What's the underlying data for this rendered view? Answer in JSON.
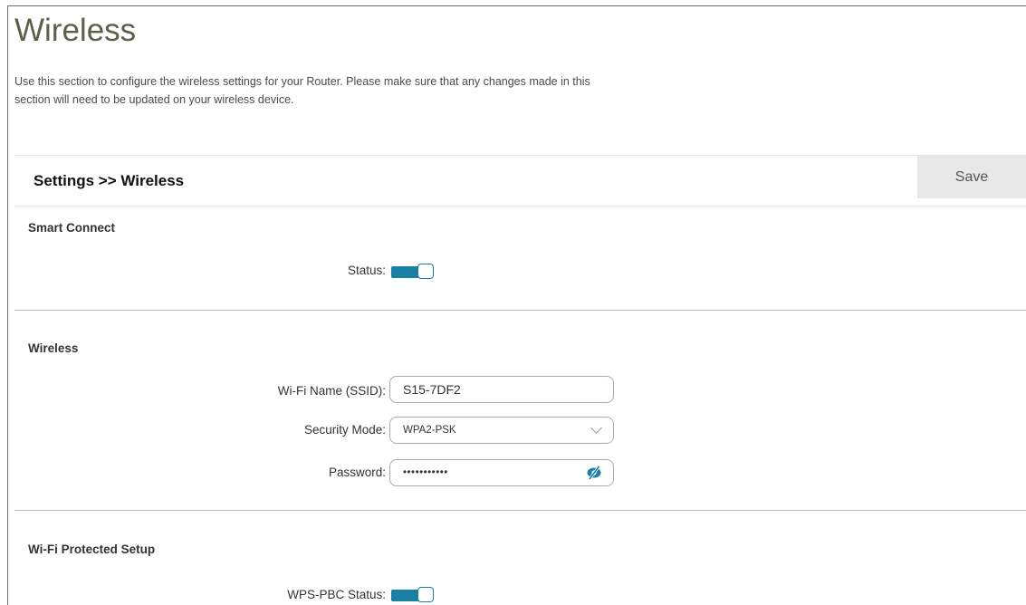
{
  "page": {
    "title": "Wireless",
    "intro": "Use this section to configure the wireless settings for your Router. Please make sure that any changes made in this section will need to be updated on your wireless device."
  },
  "toolbar": {
    "breadcrumb": "Settings >> Wireless",
    "save_label": "Save"
  },
  "smart_connect": {
    "heading": "Smart Connect",
    "status_label": "Status:",
    "status_on": true
  },
  "wireless": {
    "heading": "Wireless",
    "ssid_label": "Wi-Fi Name (SSID):",
    "ssid_value": "S15-7DF2",
    "security_label": "Security Mode:",
    "security_value": "WPA2-PSK",
    "password_label": "Password:",
    "password_value": "•••••••••••"
  },
  "wps": {
    "heading": "Wi-Fi Protected Setup",
    "pbc_label": "WPS-PBC Status:",
    "pbc_on": true
  },
  "colors": {
    "accent": "#1a7fa3",
    "title": "#5e5e4a",
    "save_bg": "#e8e8e8"
  },
  "icons": {
    "security_dropdown": "chevron-down-icon",
    "password_toggle": "eye-slash-icon"
  }
}
